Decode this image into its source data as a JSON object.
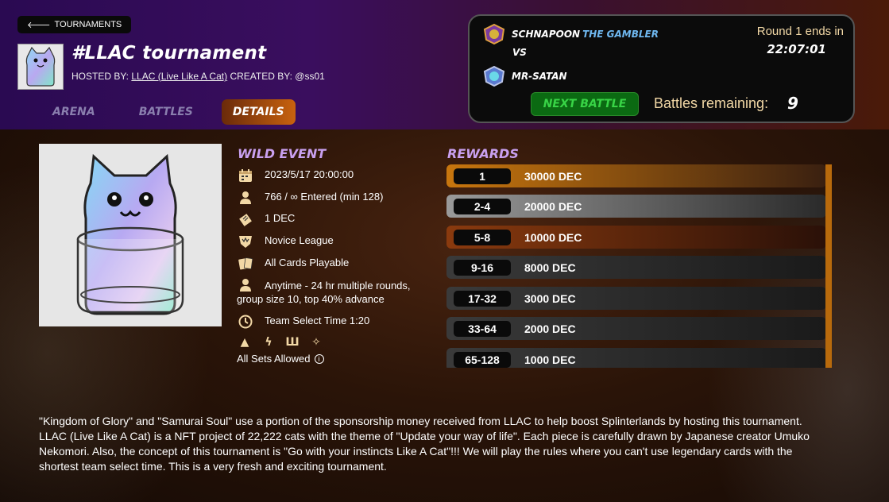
{
  "header": {
    "back_label": "TOURNAMENTS",
    "title": "#LLAC tournament",
    "hosted_by_label": "HOSTED BY:",
    "host": "LLAC (Live Like A Cat)",
    "created_by_label": "CREATED BY:",
    "creator": "@ss01"
  },
  "tabs": [
    {
      "label": "ARENA",
      "active": false
    },
    {
      "label": "BATTLES",
      "active": false
    },
    {
      "label": "DETAILS",
      "active": true
    }
  ],
  "battle": {
    "player1": "SCHNAPOON",
    "player1_tag": "THE GAMBLER",
    "vs": "VS",
    "player2": "MR-SATAN",
    "round_text": "Round 1 ends in",
    "timer": "22:07:01",
    "next_label": "NEXT BATTLE",
    "remaining_label": "Battles remaining:",
    "remaining_count": "9"
  },
  "details": {
    "heading": "WILD EVENT",
    "items": [
      {
        "icon": "calendar-icon",
        "text": "2023/5/17 20:00:00"
      },
      {
        "icon": "person-icon",
        "text": "766 / ∞ Entered (min 128)"
      },
      {
        "icon": "ticket-icon",
        "text": "1 DEC"
      },
      {
        "icon": "league-badge-icon",
        "text": "Novice League"
      },
      {
        "icon": "cards-icon",
        "text": "All Cards Playable"
      },
      {
        "icon": "person-icon",
        "text": "Anytime - 24 hr multiple rounds,",
        "text2": "group size 10, top 40% advance"
      },
      {
        "icon": "clock-icon",
        "text": "Team Select Time 1:20"
      }
    ],
    "sets_label": "All Sets Allowed"
  },
  "rewards": {
    "heading": "REWARDS",
    "rows": [
      {
        "rank": "1",
        "amount": "30000 DEC",
        "color": "#c8760e"
      },
      {
        "rank": "2-4",
        "amount": "20000 DEC",
        "color": "#8a8a8a"
      },
      {
        "rank": "5-8",
        "amount": "10000 DEC",
        "color": "#8a3a0e"
      },
      {
        "rank": "9-16",
        "amount": "8000 DEC",
        "color": "#3a3a3a"
      },
      {
        "rank": "17-32",
        "amount": "3000 DEC",
        "color": "#3a3a3a"
      },
      {
        "rank": "33-64",
        "amount": "2000 DEC",
        "color": "#3a3a3a"
      },
      {
        "rank": "65-128",
        "amount": "1000 DEC",
        "color": "#3a3a3a"
      }
    ]
  },
  "description": "\"Kingdom of Glory\" and \"Samurai Soul\" use a portion of the sponsorship money received from LLAC to help boost Splinterlands by hosting this tournament. LLAC (Live Like A Cat) is a NFT project of 22,222 cats with the theme of \"Update your way of life\". Each piece is carefully drawn by Japanese creator Umuko Nekomori. Also, the concept of this tournament is \"Go with your instincts Like A Cat\"!!! We will play the rules where you can't use legendary cards with the shortest team select time. This is a very fresh and exciting tournament."
}
